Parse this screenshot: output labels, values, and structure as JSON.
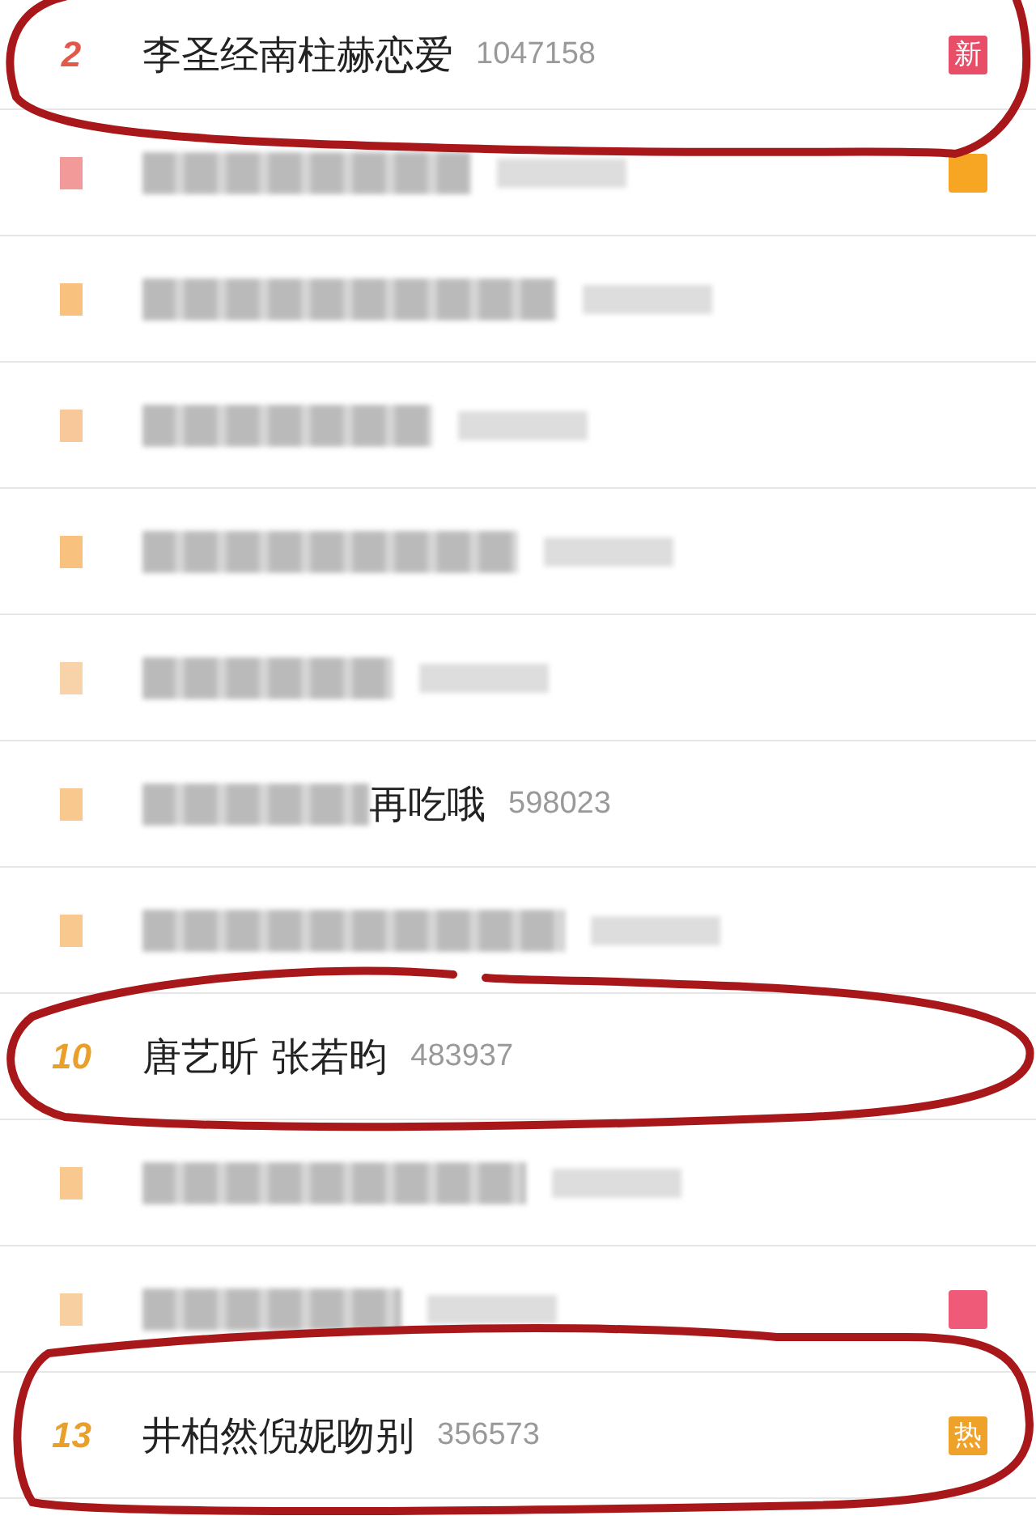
{
  "rows": [
    {
      "kind": "clear",
      "rank": "2",
      "color": "#e4574b",
      "title": "李圣经南柱赫恋爱",
      "count": "1047158",
      "badge": {
        "kind": "text",
        "text": "新",
        "color": "#e84e68"
      }
    },
    {
      "kind": "blurred",
      "color": "#f29a9a",
      "badge": {
        "kind": "blurred",
        "color": "#f6a623"
      }
    },
    {
      "kind": "blurred",
      "color": "#f8c17e"
    },
    {
      "kind": "blurred",
      "color": "#f8c79a"
    },
    {
      "kind": "blurred",
      "color": "#f8c17e"
    },
    {
      "kind": "blurred",
      "color": "#f8d2a8"
    },
    {
      "kind": "partial",
      "color": "#f8c88e",
      "title": "再吃哦",
      "count": "598023"
    },
    {
      "kind": "blurred",
      "color": "#f8c88e"
    },
    {
      "kind": "clear",
      "rank": "10",
      "color": "#e9a02a",
      "title": "唐艺昕 张若昀",
      "count": "483937"
    },
    {
      "kind": "blurred",
      "color": "#f8c88e"
    },
    {
      "kind": "blurred",
      "color": "#f8cfa0",
      "badge": {
        "kind": "blurred",
        "color": "#ee5a78"
      }
    },
    {
      "kind": "clear",
      "rank": "13",
      "color": "#e9a02a",
      "title": "井柏然倪妮吻别",
      "count": "356573",
      "badge": {
        "kind": "text",
        "text": "热",
        "color": "#eea22a"
      }
    }
  ],
  "annotations": [
    {
      "kind": "circle"
    },
    {
      "kind": "circle"
    },
    {
      "kind": "circle"
    }
  ]
}
